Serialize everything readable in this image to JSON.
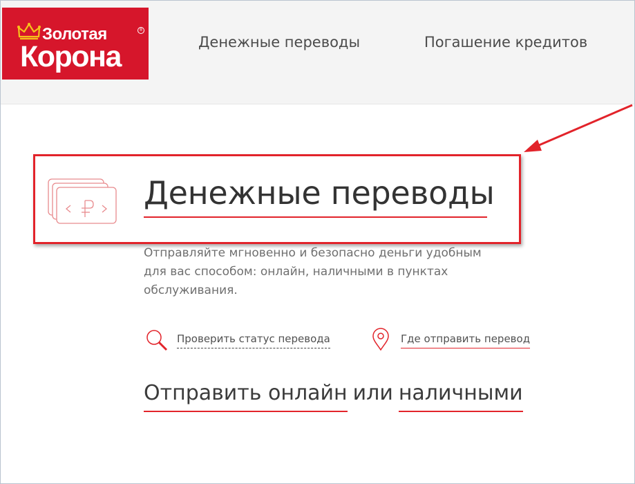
{
  "logo": {
    "line1": "Золотая",
    "line2": "Корона",
    "reg_mark": "®"
  },
  "nav": {
    "items": [
      {
        "label": "Денежные переводы"
      },
      {
        "label": "Погашение кредитов"
      }
    ]
  },
  "main": {
    "title": "Денежные переводы",
    "description": "Отправляйте мгновенно и безопасно деньги удобным для вас способом: онлайн, наличными в пунктах обслуживания.",
    "links": {
      "check_status": "Проверить статус перевода",
      "where_to_send": "Где отправить перевод"
    },
    "send": {
      "online": "Отправить онлайн",
      "or": "или",
      "cash": "наличными"
    }
  },
  "icons": {
    "logo": "crown-icon",
    "money": "money-transfer-icon",
    "search": "search-icon",
    "pin": "location-pin-icon",
    "annotation": "arrow-annotation"
  },
  "colors": {
    "brand_red": "#d6162b",
    "accent_red": "#e2232a",
    "header_bg": "#f4f4f4"
  }
}
